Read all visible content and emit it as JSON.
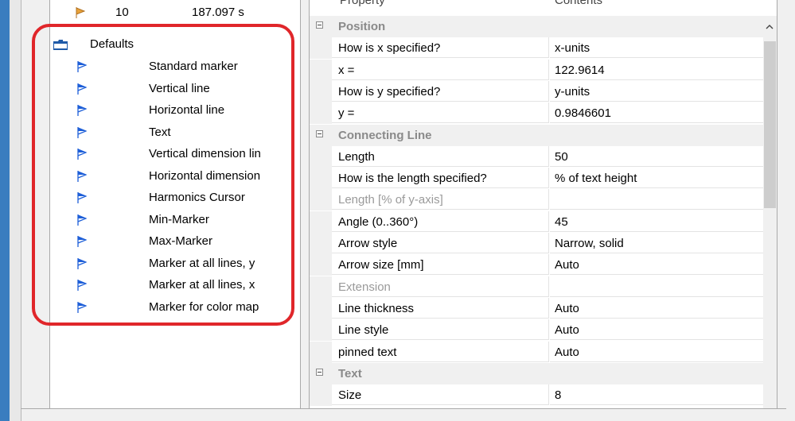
{
  "colors": {
    "highlight": "#e0262a",
    "flag_blue": "#1e5fd8",
    "flag_orange": "#e8a23a",
    "folder": "#1f5aa8"
  },
  "tree": {
    "partial_row": {
      "index": "10",
      "time": "187.097 s",
      "icon": "orange-flag-icon"
    },
    "folder": {
      "label": "Defaults",
      "icon": "folder-icon"
    },
    "items": [
      {
        "label": "Standard marker",
        "icon": "blue-flag-icon"
      },
      {
        "label": "Vertical line",
        "icon": "blue-flag-icon"
      },
      {
        "label": "Horizontal line",
        "icon": "blue-flag-icon"
      },
      {
        "label": "Text",
        "icon": "blue-flag-icon"
      },
      {
        "label": "Vertical dimension lin",
        "icon": "blue-flag-icon"
      },
      {
        "label": "Horizontal dimension",
        "icon": "blue-flag-icon"
      },
      {
        "label": "Harmonics Cursor",
        "icon": "blue-flag-icon"
      },
      {
        "label": "Min-Marker",
        "icon": "blue-flag-icon"
      },
      {
        "label": "Max-Marker",
        "icon": "blue-flag-icon"
      },
      {
        "label": "Marker at all lines, y",
        "icon": "blue-flag-icon"
      },
      {
        "label": "Marker at all lines, x",
        "icon": "blue-flag-icon"
      },
      {
        "label": "Marker for color map",
        "icon": "blue-flag-icon"
      }
    ]
  },
  "grid": {
    "header": {
      "property": "Property",
      "contents": "Contents"
    },
    "rows": [
      {
        "kind": "category",
        "label": "Position"
      },
      {
        "kind": "prop",
        "name": "How is x specified?",
        "value": "x-units"
      },
      {
        "kind": "prop",
        "name": "x =",
        "value": "122.9614"
      },
      {
        "kind": "prop",
        "name": "How is y specified?",
        "value": "y-units"
      },
      {
        "kind": "prop",
        "name": "y =",
        "value": "0.9846601"
      },
      {
        "kind": "category",
        "label": "Connecting Line"
      },
      {
        "kind": "prop",
        "name": "Length",
        "value": "50"
      },
      {
        "kind": "prop",
        "name": "How is the length specified?",
        "value": "% of text height"
      },
      {
        "kind": "prop",
        "name": "Length [% of y-axis]",
        "value": "",
        "disabled": true
      },
      {
        "kind": "prop",
        "name": "Angle (0..360°)",
        "value": "45"
      },
      {
        "kind": "prop",
        "name": "Arrow style",
        "value": "Narrow, solid"
      },
      {
        "kind": "prop",
        "name": "Arrow size [mm]",
        "value": "Auto"
      },
      {
        "kind": "prop",
        "name": "Extension",
        "value": "",
        "disabled": true
      },
      {
        "kind": "prop",
        "name": "Line thickness",
        "value": "Auto"
      },
      {
        "kind": "prop",
        "name": "Line style",
        "value": "Auto"
      },
      {
        "kind": "prop",
        "name": "pinned text",
        "value": "Auto"
      },
      {
        "kind": "category",
        "label": "Text"
      },
      {
        "kind": "prop",
        "name": "Size",
        "value": "8"
      }
    ]
  }
}
